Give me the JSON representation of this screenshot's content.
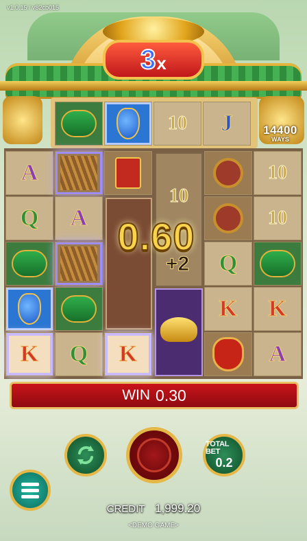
{
  "version_text": "v1.0.15 / v82cb015",
  "multiplier": {
    "value": "3",
    "suffix": "x"
  },
  "ways": {
    "number": "14400",
    "label": "WAYS"
  },
  "big_win_amount": "0.60",
  "bonus_label": "+2",
  "top_row": [
    "frog",
    "gourd",
    "10",
    "J"
  ],
  "grid_rows": [
    [
      "A",
      "blur",
      "envelope",
      "tall",
      "coin",
      "10"
    ],
    [
      "Q",
      "A",
      "tall",
      "10",
      "coin",
      "10"
    ],
    [
      "frog",
      "blur",
      "tall",
      "tall",
      "Q",
      "frog"
    ],
    [
      "gourd",
      "frog",
      "tall",
      "ingot",
      "K",
      "K"
    ],
    [
      "K",
      "Q",
      "K",
      "ingot",
      "bag",
      "A"
    ]
  ],
  "win": {
    "label": "WIN",
    "value": "0.30"
  },
  "total_bet": {
    "label": "TOTAL BET",
    "value": "0.2"
  },
  "credit": {
    "label": "CREDIT",
    "value": "1,999.20"
  },
  "demo_label": "<DEMO GAME>",
  "colors": {
    "win_bar": "#c9141a",
    "gold_trim": "#e4b746",
    "button_green": "#2e8e58"
  }
}
